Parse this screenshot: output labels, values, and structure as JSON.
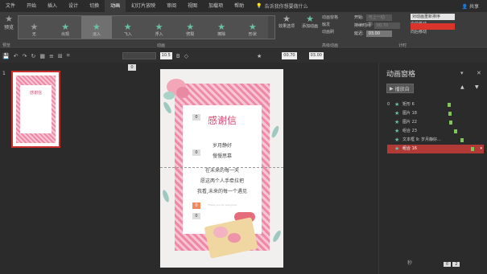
{
  "menu": {
    "items": [
      "文件",
      "开始",
      "插入",
      "设计",
      "切换",
      "动画",
      "幻灯片放映",
      "审阅",
      "视图",
      "加载项",
      "帮助"
    ],
    "active_index": 5,
    "search": "告诉我你想要做什么",
    "share": "共享"
  },
  "ribbon": {
    "preview_label": "预览",
    "gallery": [
      "无",
      "出现",
      "淡入",
      "飞入",
      "浮入",
      "劈裂",
      "擦除",
      "形状"
    ],
    "gallery_selected": 2,
    "effect_options": "效果选项",
    "add_animation": "添加动画",
    "advanced": [
      "动画窗格",
      "触发",
      "动画刷"
    ],
    "timing": {
      "start_label": "开始:",
      "start_value": "与上一动画...",
      "duration_label": "持续时间:",
      "duration_value": "00.70",
      "delay_label": "延迟:",
      "delay_value": "03.00"
    },
    "reorder": {
      "title": "对动画重新排序",
      "forward": "向前移动",
      "backward": "向后移动"
    },
    "group_labels": [
      "预览",
      "动画",
      "高级动画",
      "计时"
    ]
  },
  "toolbar2": {
    "zoom1": "10.5",
    "val1": "00.70",
    "val2": "03.00"
  },
  "thumb": {
    "number": "1",
    "title": "感谢信"
  },
  "slide": {
    "ruler_number": "0",
    "title": "感谢信",
    "lines": [
      "岁月静好",
      "慢慢思慕",
      "在未来的每一天",
      "愿这两个人手牵拉把",
      "我看,未来的每一个遇见"
    ],
    "small": "Thank you for everyone",
    "badges": [
      "0",
      "0",
      "0",
      "0"
    ]
  },
  "pane": {
    "title": "动画窗格",
    "play_label": "播放自",
    "items": [
      {
        "num": "0",
        "label": "矩形 6",
        "selected": false
      },
      {
        "num": "",
        "label": "图片 18",
        "selected": false
      },
      {
        "num": "",
        "label": "图片 22",
        "selected": false
      },
      {
        "num": "",
        "label": "组合 23",
        "selected": false
      },
      {
        "num": "",
        "label": "文本框 9: 岁月静好...",
        "selected": false
      },
      {
        "num": "",
        "label": "组合 16",
        "selected": true
      }
    ],
    "footer_label": "秒",
    "page_labels": [
      "0",
      "2"
    ]
  }
}
